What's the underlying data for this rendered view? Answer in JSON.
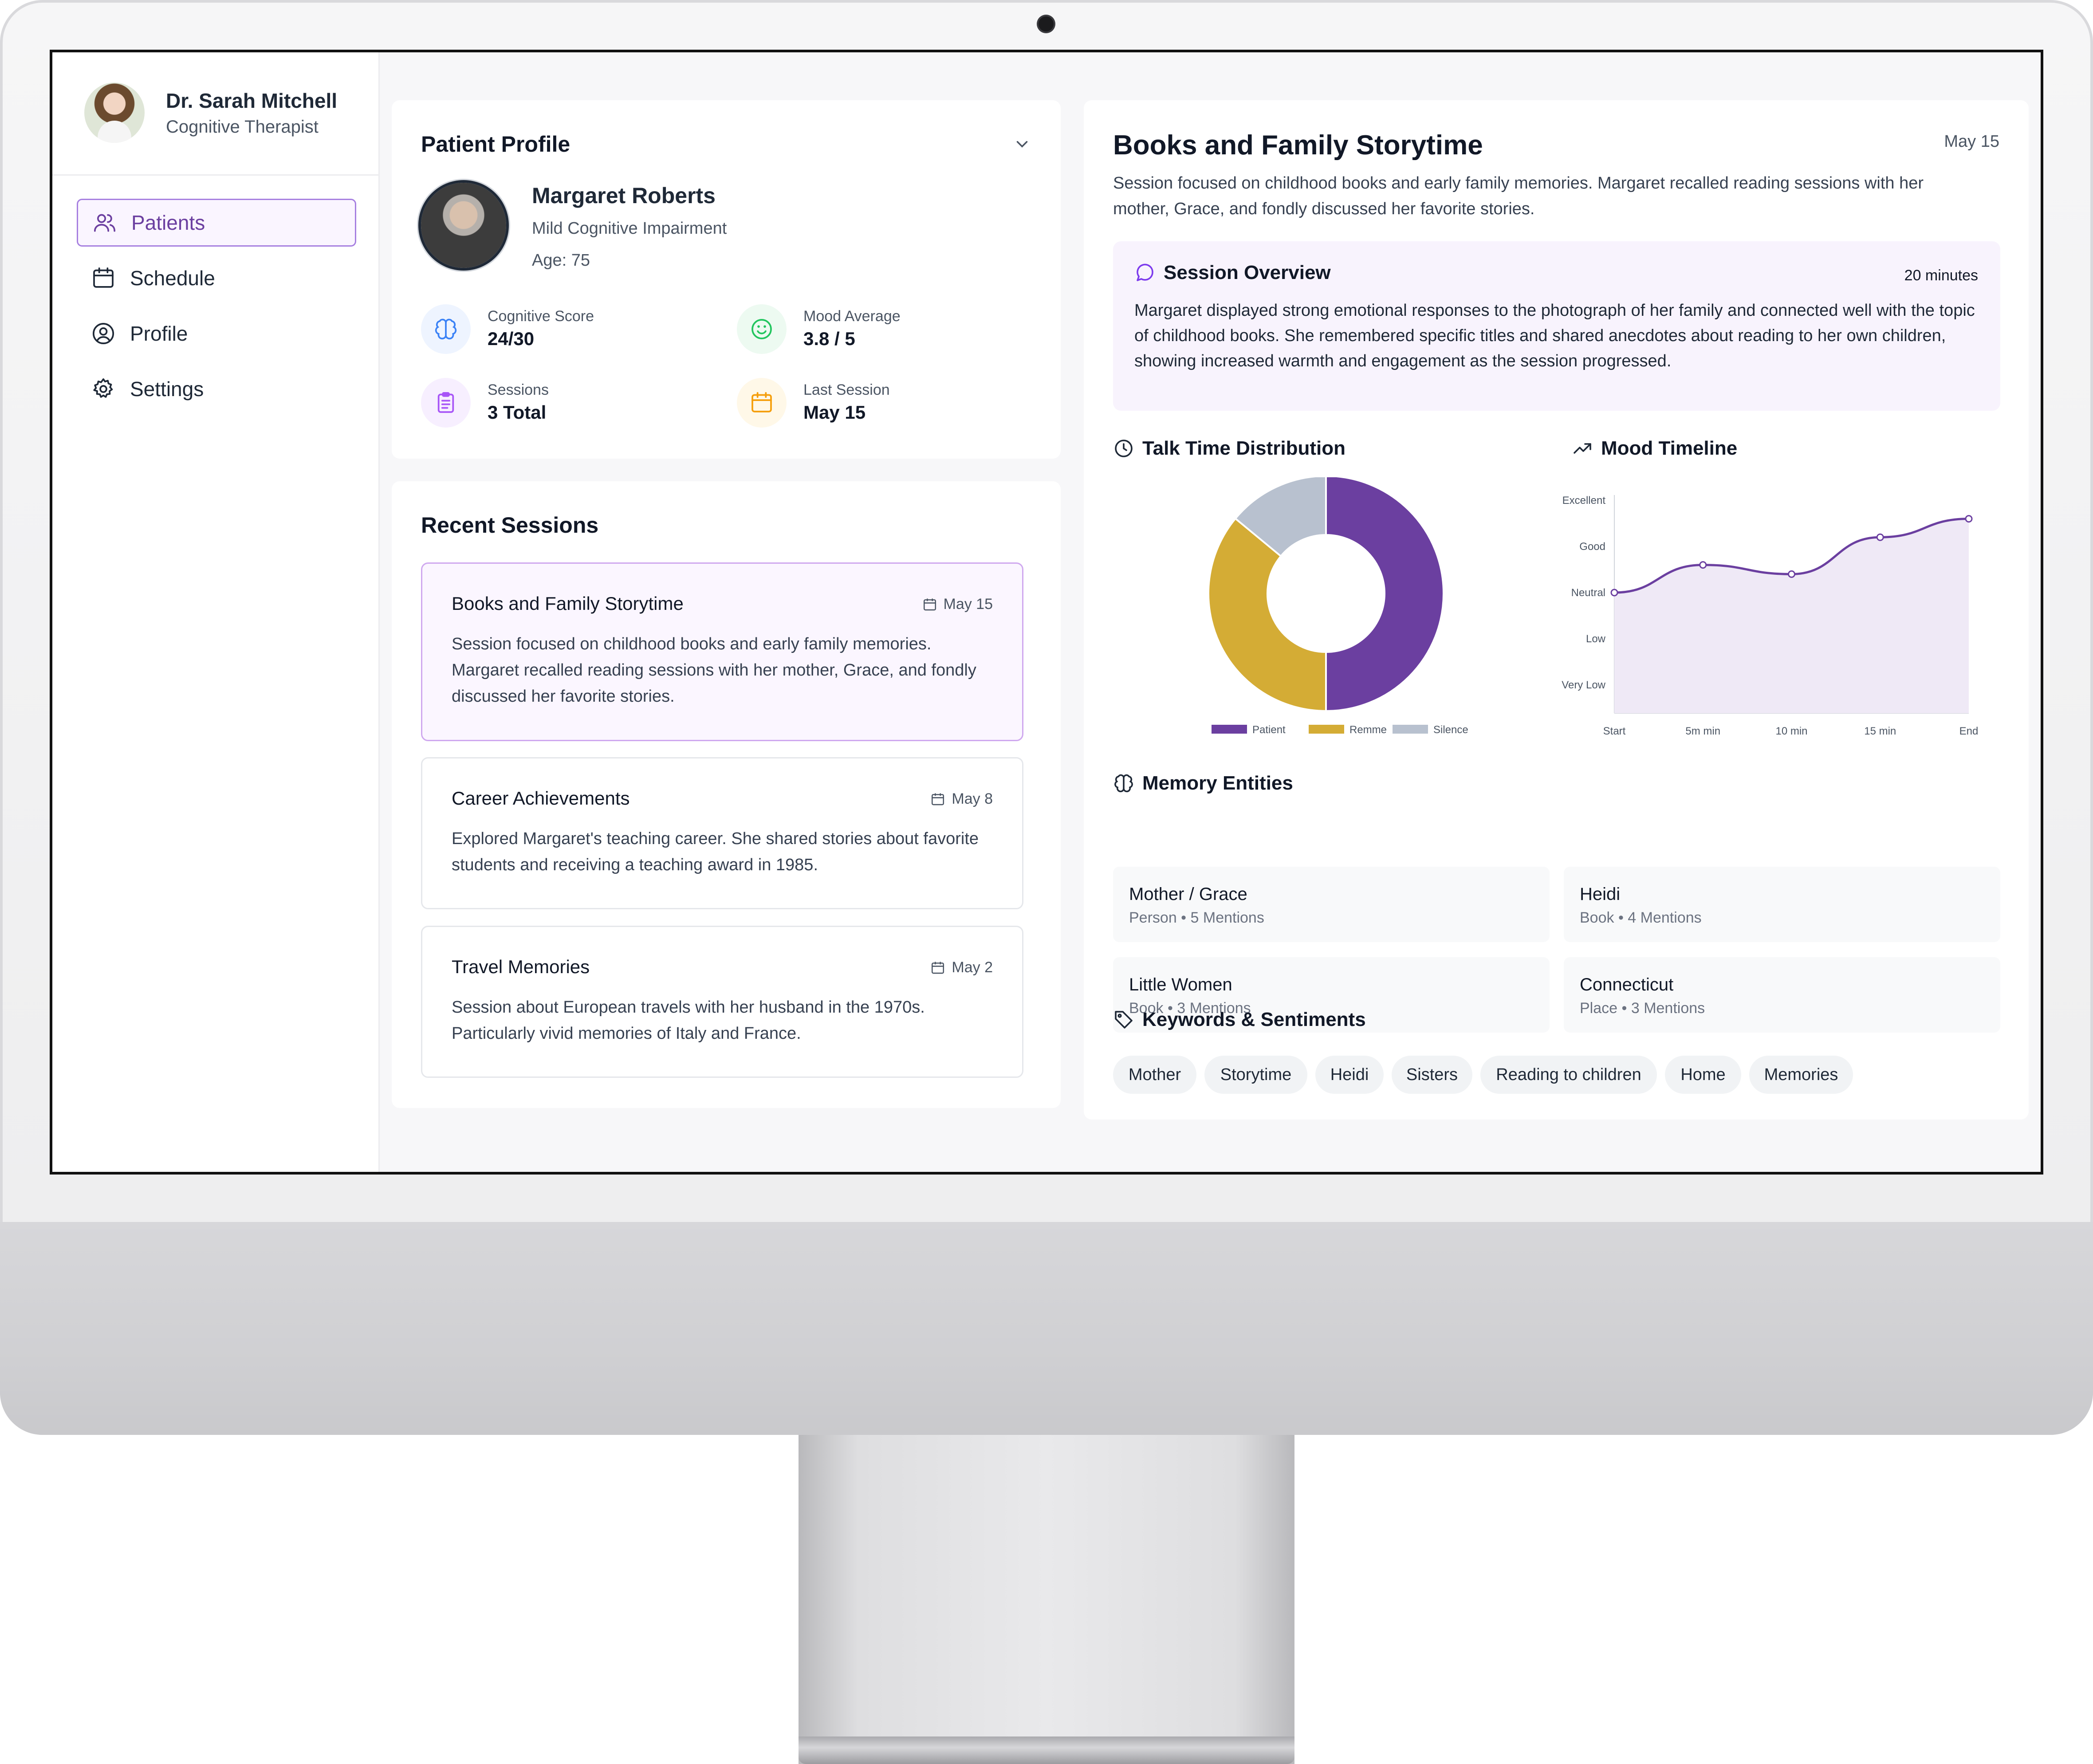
{
  "therapist": {
    "name": "Dr. Sarah Mitchell",
    "role": "Cognitive Therapist"
  },
  "nav": {
    "items": [
      {
        "label": "Patients",
        "icon": "users-icon",
        "active": true
      },
      {
        "label": "Schedule",
        "icon": "calendar-icon",
        "active": false
      },
      {
        "label": "Profile",
        "icon": "user-circle-icon",
        "active": false
      },
      {
        "label": "Settings",
        "icon": "gear-icon",
        "active": false
      }
    ]
  },
  "patient_profile": {
    "title": "Patient Profile",
    "name": "Margaret Roberts",
    "condition": "Mild Cognitive Impairment",
    "age": "Age: 75",
    "stats": [
      {
        "label": "Cognitive Score",
        "value": "24/30",
        "icon": "brain-icon",
        "color": "#3b82f6"
      },
      {
        "label": "Mood Average",
        "value": "3.8 / 5",
        "icon": "smile-icon",
        "color": "#22c55e"
      },
      {
        "label": "Sessions",
        "value": "3 Total",
        "icon": "clipboard-icon",
        "color": "#a855f7"
      },
      {
        "label": "Last Session",
        "value": "May 15",
        "icon": "calendar-icon",
        "color": "#f59e0b"
      }
    ]
  },
  "recent_sessions": {
    "title": "Recent Sessions",
    "items": [
      {
        "title": "Books and Family Storytime",
        "date": "May 15",
        "desc": "Session focused on childhood books and early family memories. Margaret recalled reading sessions with her mother, Grace, and fondly discussed her favorite stories.",
        "active": true
      },
      {
        "title": "Career Achievements",
        "date": "May 8",
        "desc": "Explored Margaret's teaching career. She shared stories about favorite students and receiving a teaching award in 1985.",
        "active": false
      },
      {
        "title": "Travel Memories",
        "date": "May 2",
        "desc": "Session about European travels with her husband in the 1970s. Particularly vivid memories of Italy and France.",
        "active": false
      }
    ]
  },
  "detail": {
    "title": "Books and Family Storytime",
    "date": "May 15",
    "desc": "Session focused on childhood books and early family memories. Margaret recalled reading sessions with her mother, Grace, and fondly discussed her favorite stories.",
    "overview": {
      "title": "Session Overview",
      "duration": "20 minutes",
      "text": "Margaret displayed strong emotional responses to the photograph of her family and connected well with the topic of childhood books. She remembered specific titles and shared anecdotes about reading to her own children, showing increased warmth and engagement as the session progressed."
    },
    "talk_time_title": "Talk Time Distribution",
    "mood_title": "Mood Timeline",
    "entities_title": "Memory Entities",
    "entities": [
      {
        "name": "Mother / Grace",
        "meta": "Person • 5 Mentions"
      },
      {
        "name": "Heidi",
        "meta": "Book • 4 Mentions"
      },
      {
        "name": "Little Women",
        "meta": "Book • 3 Mentions"
      },
      {
        "name": "Connecticut",
        "meta": "Place • 3 Mentions"
      }
    ],
    "keywords_title": "Keywords & Sentiments",
    "keywords": [
      "Mother",
      "Storytime",
      "Heidi",
      "Sisters",
      "Reading to children",
      "Home",
      "Memories"
    ]
  },
  "chart_data": [
    {
      "type": "pie",
      "title": "Talk Time Distribution",
      "categories": [
        "Patient",
        "Remme",
        "Silence"
      ],
      "values": [
        50,
        36,
        14
      ],
      "colors": [
        "#6b3fa0",
        "#d4ac35",
        "#b8c1cf"
      ],
      "legend": "bottom"
    },
    {
      "type": "area",
      "title": "Mood Timeline",
      "categories": [
        "Start",
        "5m min",
        "10 min",
        "15 min",
        "End"
      ],
      "y_tick_labels": [
        "Very Low",
        "Low",
        "Neutral",
        "Good",
        "Excellent"
      ],
      "series": [
        {
          "values": [
            3.0,
            3.6,
            3.4,
            4.2,
            4.6
          ]
        }
      ],
      "ylim": [
        1,
        5
      ],
      "color": "#6b3fa0"
    }
  ]
}
